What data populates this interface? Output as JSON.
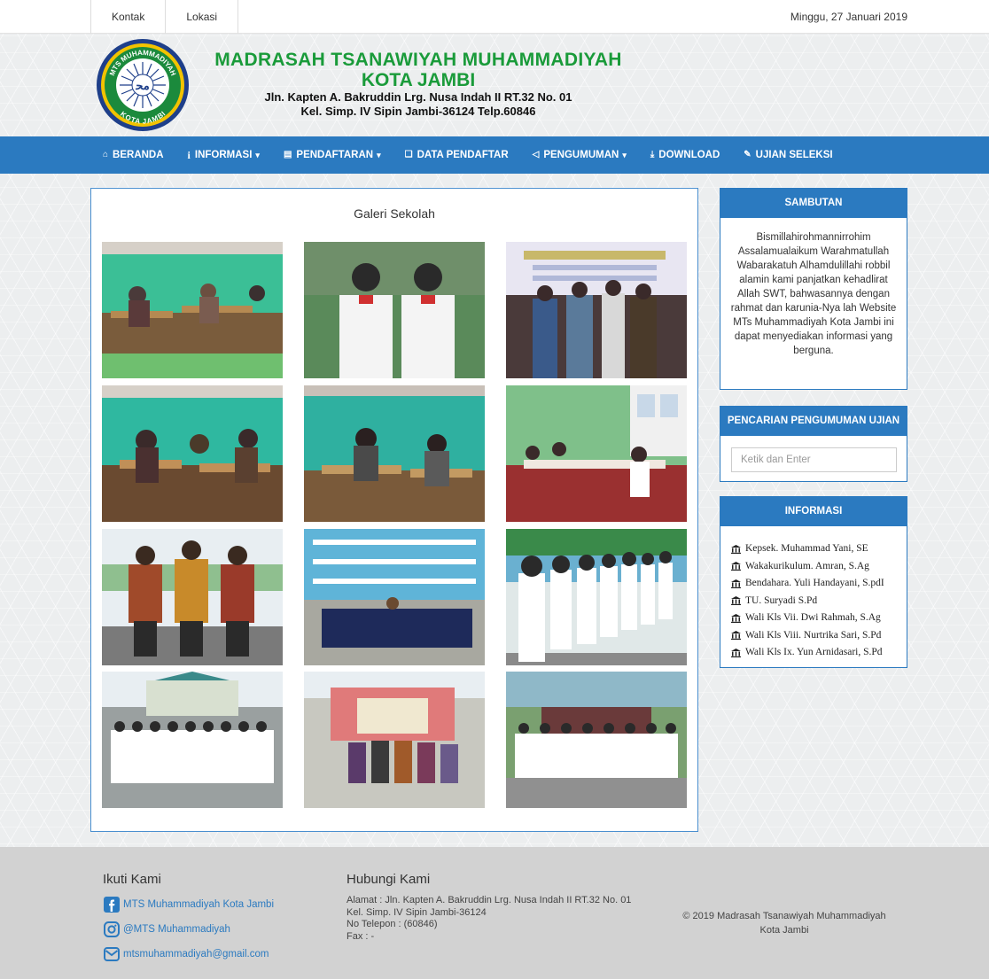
{
  "topbar": {
    "links": [
      "Kontak",
      "Lokasi"
    ],
    "date": "Minggu, 27 Januari 2019"
  },
  "header": {
    "title_line1": "MADRASAH TSANAWIYAH MUHAMMADIYAH",
    "title_line2": "KOTA JAMBI",
    "address_line1": "Jln. Kapten A. Bakruddin Lrg. Nusa Indah II RT.32 No. 01",
    "address_line2": "Kel. Simp. IV Sipin Jambi-36124 Telp.60846",
    "logo_text_top": "MTS MUHAMMADIYAH",
    "logo_text_bottom": "KOTA JAMBI"
  },
  "nav": {
    "items": [
      {
        "label": "BERANDA",
        "icon": "home-icon",
        "dropdown": false
      },
      {
        "label": "INFORMASI",
        "icon": "info-icon",
        "dropdown": true
      },
      {
        "label": "PENDAFTARAN",
        "icon": "book-icon",
        "dropdown": true
      },
      {
        "label": "DATA PENDAFTAR",
        "icon": "copy-icon",
        "dropdown": false
      },
      {
        "label": "PENGUMUMAN",
        "icon": "bullhorn-icon",
        "dropdown": true
      },
      {
        "label": "DOWNLOAD",
        "icon": "download-icon",
        "dropdown": false
      },
      {
        "label": "UJIAN SELEKSI",
        "icon": "pencil-icon",
        "dropdown": false
      }
    ]
  },
  "gallery": {
    "title": "Galeri Sekolah"
  },
  "sidebar": {
    "sambutan": {
      "title": "SAMBUTAN",
      "text": "Bismillahirohmannirrohim Assalamualaikum Warahmatullah Wabarakatuh Alhamdulillahi robbil alamin kami panjatkan kehadlirat Allah SWT, bahwasannya dengan rahmat dan karunia-Nya lah Website MTs Muhammadiyah Kota Jambi ini dapat menyediakan informasi yang berguna."
    },
    "pencarian": {
      "title": "PENCARIAN PENGUMUMAN UJIAN",
      "placeholder": "Ketik dan Enter"
    },
    "informasi": {
      "title": "INFORMASI",
      "items": [
        "Kepsek. Muhammad Yani, SE",
        "Wakakurikulum. Amran, S.Ag",
        "Bendahara. Yuli Handayani, S.pdI",
        "TU. Suryadi S.Pd",
        "Wali Kls Vii. Dwi Rahmah, S.Ag",
        "Wali Kls Viii. Nurtrika Sari, S.Pd",
        "Wali Kls Ix. Yun Arnidasari, S.Pd"
      ]
    }
  },
  "footer": {
    "follow_title": "Ikuti Kami",
    "facebook": "MTS Muhammadiyah Kota Jambi",
    "instagram": "@MTS Muhammadiyah",
    "email": "mtsmuhammadiyah@gmail.com",
    "contact_title": "Hubungi Kami",
    "address1": "Alamat : Jln. Kapten A. Bakruddin Lrg. Nusa Indah II RT.32 No. 01",
    "address2": "Kel. Simp. IV Sipin Jambi-36124",
    "phone": "No Telepon : (60846)",
    "fax": "Fax : -",
    "copyright1": "© 2019 Madrasah Tsanawiyah Muhammadiyah",
    "copyright2": "Kota Jambi"
  },
  "colors": {
    "primary_blue": "#2b7ac0",
    "title_green": "#1a9b3a",
    "footer_gray": "#d2d2d2"
  }
}
